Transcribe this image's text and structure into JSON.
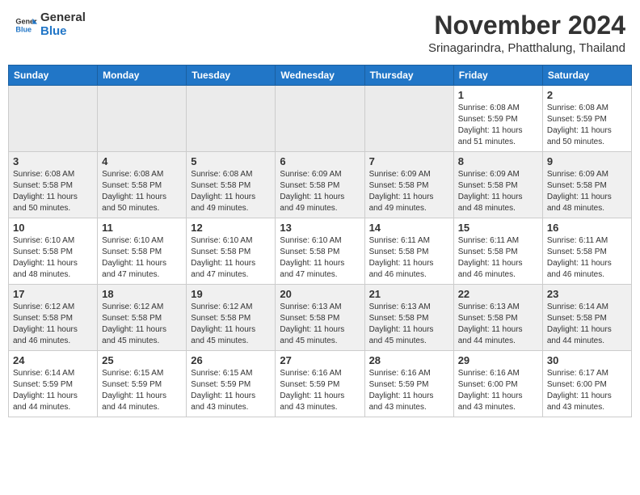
{
  "header": {
    "logo_general": "General",
    "logo_blue": "Blue",
    "month_title": "November 2024",
    "location": "Srinagarindra, Phatthalung, Thailand"
  },
  "weekdays": [
    "Sunday",
    "Monday",
    "Tuesday",
    "Wednesday",
    "Thursday",
    "Friday",
    "Saturday"
  ],
  "weeks": [
    [
      {
        "day": "",
        "sunrise": "",
        "sunset": "",
        "daylight": "",
        "empty": true
      },
      {
        "day": "",
        "sunrise": "",
        "sunset": "",
        "daylight": "",
        "empty": true
      },
      {
        "day": "",
        "sunrise": "",
        "sunset": "",
        "daylight": "",
        "empty": true
      },
      {
        "day": "",
        "sunrise": "",
        "sunset": "",
        "daylight": "",
        "empty": true
      },
      {
        "day": "",
        "sunrise": "",
        "sunset": "",
        "daylight": "",
        "empty": true
      },
      {
        "day": "1",
        "sunrise": "Sunrise: 6:08 AM",
        "sunset": "Sunset: 5:59 PM",
        "daylight": "Daylight: 11 hours and 51 minutes.",
        "empty": false
      },
      {
        "day": "2",
        "sunrise": "Sunrise: 6:08 AM",
        "sunset": "Sunset: 5:59 PM",
        "daylight": "Daylight: 11 hours and 50 minutes.",
        "empty": false
      }
    ],
    [
      {
        "day": "3",
        "sunrise": "Sunrise: 6:08 AM",
        "sunset": "Sunset: 5:58 PM",
        "daylight": "Daylight: 11 hours and 50 minutes.",
        "empty": false
      },
      {
        "day": "4",
        "sunrise": "Sunrise: 6:08 AM",
        "sunset": "Sunset: 5:58 PM",
        "daylight": "Daylight: 11 hours and 50 minutes.",
        "empty": false
      },
      {
        "day": "5",
        "sunrise": "Sunrise: 6:08 AM",
        "sunset": "Sunset: 5:58 PM",
        "daylight": "Daylight: 11 hours and 49 minutes.",
        "empty": false
      },
      {
        "day": "6",
        "sunrise": "Sunrise: 6:09 AM",
        "sunset": "Sunset: 5:58 PM",
        "daylight": "Daylight: 11 hours and 49 minutes.",
        "empty": false
      },
      {
        "day": "7",
        "sunrise": "Sunrise: 6:09 AM",
        "sunset": "Sunset: 5:58 PM",
        "daylight": "Daylight: 11 hours and 49 minutes.",
        "empty": false
      },
      {
        "day": "8",
        "sunrise": "Sunrise: 6:09 AM",
        "sunset": "Sunset: 5:58 PM",
        "daylight": "Daylight: 11 hours and 48 minutes.",
        "empty": false
      },
      {
        "day": "9",
        "sunrise": "Sunrise: 6:09 AM",
        "sunset": "Sunset: 5:58 PM",
        "daylight": "Daylight: 11 hours and 48 minutes.",
        "empty": false
      }
    ],
    [
      {
        "day": "10",
        "sunrise": "Sunrise: 6:10 AM",
        "sunset": "Sunset: 5:58 PM",
        "daylight": "Daylight: 11 hours and 48 minutes.",
        "empty": false
      },
      {
        "day": "11",
        "sunrise": "Sunrise: 6:10 AM",
        "sunset": "Sunset: 5:58 PM",
        "daylight": "Daylight: 11 hours and 47 minutes.",
        "empty": false
      },
      {
        "day": "12",
        "sunrise": "Sunrise: 6:10 AM",
        "sunset": "Sunset: 5:58 PM",
        "daylight": "Daylight: 11 hours and 47 minutes.",
        "empty": false
      },
      {
        "day": "13",
        "sunrise": "Sunrise: 6:10 AM",
        "sunset": "Sunset: 5:58 PM",
        "daylight": "Daylight: 11 hours and 47 minutes.",
        "empty": false
      },
      {
        "day": "14",
        "sunrise": "Sunrise: 6:11 AM",
        "sunset": "Sunset: 5:58 PM",
        "daylight": "Daylight: 11 hours and 46 minutes.",
        "empty": false
      },
      {
        "day": "15",
        "sunrise": "Sunrise: 6:11 AM",
        "sunset": "Sunset: 5:58 PM",
        "daylight": "Daylight: 11 hours and 46 minutes.",
        "empty": false
      },
      {
        "day": "16",
        "sunrise": "Sunrise: 6:11 AM",
        "sunset": "Sunset: 5:58 PM",
        "daylight": "Daylight: 11 hours and 46 minutes.",
        "empty": false
      }
    ],
    [
      {
        "day": "17",
        "sunrise": "Sunrise: 6:12 AM",
        "sunset": "Sunset: 5:58 PM",
        "daylight": "Daylight: 11 hours and 46 minutes.",
        "empty": false
      },
      {
        "day": "18",
        "sunrise": "Sunrise: 6:12 AM",
        "sunset": "Sunset: 5:58 PM",
        "daylight": "Daylight: 11 hours and 45 minutes.",
        "empty": false
      },
      {
        "day": "19",
        "sunrise": "Sunrise: 6:12 AM",
        "sunset": "Sunset: 5:58 PM",
        "daylight": "Daylight: 11 hours and 45 minutes.",
        "empty": false
      },
      {
        "day": "20",
        "sunrise": "Sunrise: 6:13 AM",
        "sunset": "Sunset: 5:58 PM",
        "daylight": "Daylight: 11 hours and 45 minutes.",
        "empty": false
      },
      {
        "day": "21",
        "sunrise": "Sunrise: 6:13 AM",
        "sunset": "Sunset: 5:58 PM",
        "daylight": "Daylight: 11 hours and 45 minutes.",
        "empty": false
      },
      {
        "day": "22",
        "sunrise": "Sunrise: 6:13 AM",
        "sunset": "Sunset: 5:58 PM",
        "daylight": "Daylight: 11 hours and 44 minutes.",
        "empty": false
      },
      {
        "day": "23",
        "sunrise": "Sunrise: 6:14 AM",
        "sunset": "Sunset: 5:58 PM",
        "daylight": "Daylight: 11 hours and 44 minutes.",
        "empty": false
      }
    ],
    [
      {
        "day": "24",
        "sunrise": "Sunrise: 6:14 AM",
        "sunset": "Sunset: 5:59 PM",
        "daylight": "Daylight: 11 hours and 44 minutes.",
        "empty": false
      },
      {
        "day": "25",
        "sunrise": "Sunrise: 6:15 AM",
        "sunset": "Sunset: 5:59 PM",
        "daylight": "Daylight: 11 hours and 44 minutes.",
        "empty": false
      },
      {
        "day": "26",
        "sunrise": "Sunrise: 6:15 AM",
        "sunset": "Sunset: 5:59 PM",
        "daylight": "Daylight: 11 hours and 43 minutes.",
        "empty": false
      },
      {
        "day": "27",
        "sunrise": "Sunrise: 6:16 AM",
        "sunset": "Sunset: 5:59 PM",
        "daylight": "Daylight: 11 hours and 43 minutes.",
        "empty": false
      },
      {
        "day": "28",
        "sunrise": "Sunrise: 6:16 AM",
        "sunset": "Sunset: 5:59 PM",
        "daylight": "Daylight: 11 hours and 43 minutes.",
        "empty": false
      },
      {
        "day": "29",
        "sunrise": "Sunrise: 6:16 AM",
        "sunset": "Sunset: 6:00 PM",
        "daylight": "Daylight: 11 hours and 43 minutes.",
        "empty": false
      },
      {
        "day": "30",
        "sunrise": "Sunrise: 6:17 AM",
        "sunset": "Sunset: 6:00 PM",
        "daylight": "Daylight: 11 hours and 43 minutes.",
        "empty": false
      }
    ]
  ]
}
